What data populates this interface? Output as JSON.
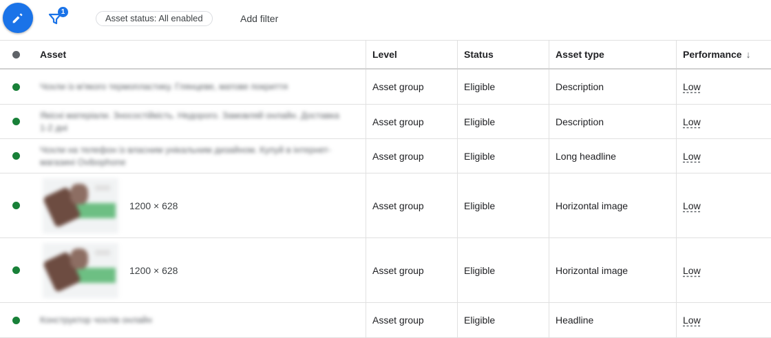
{
  "toolbar": {
    "filter_count": "1",
    "status_chip": "Asset status: All enabled",
    "add_filter": "Add filter"
  },
  "columns": {
    "asset": "Asset",
    "level": "Level",
    "status": "Status",
    "asset_type": "Asset type",
    "performance": "Performance"
  },
  "colors": {
    "accent": "#1a73e8",
    "status_green": "#188038"
  },
  "rows": [
    {
      "asset_kind": "text",
      "asset_text": "Чохли із м'якого термопластику. Глянцеве, матове покриття",
      "level": "Asset group",
      "status": "Eligible",
      "asset_type": "Description",
      "performance": "Low"
    },
    {
      "asset_kind": "text",
      "asset_text": "Якісні матеріали. Зносостійкість. Недорого. Замовляй онлайн. Доставка 1-2 дні",
      "level": "Asset group",
      "status": "Eligible",
      "asset_type": "Description",
      "performance": "Low"
    },
    {
      "asset_kind": "text",
      "asset_text": "Чохли на телефон із власним унікальним дизайном. Купуй в інтернет-магазині Ovibophone",
      "level": "Asset group",
      "status": "Eligible",
      "asset_type": "Long headline",
      "performance": "Low"
    },
    {
      "asset_kind": "image",
      "image_size": "1200 × 628",
      "level": "Asset group",
      "status": "Eligible",
      "asset_type": "Horizontal image",
      "performance": "Low"
    },
    {
      "asset_kind": "image",
      "image_size": "1200 × 628",
      "level": "Asset group",
      "status": "Eligible",
      "asset_type": "Horizontal image",
      "performance": "Low"
    },
    {
      "asset_kind": "text",
      "asset_text": "Конструктор чохлів онлайн",
      "level": "Asset group",
      "status": "Eligible",
      "asset_type": "Headline",
      "performance": "Low"
    }
  ]
}
